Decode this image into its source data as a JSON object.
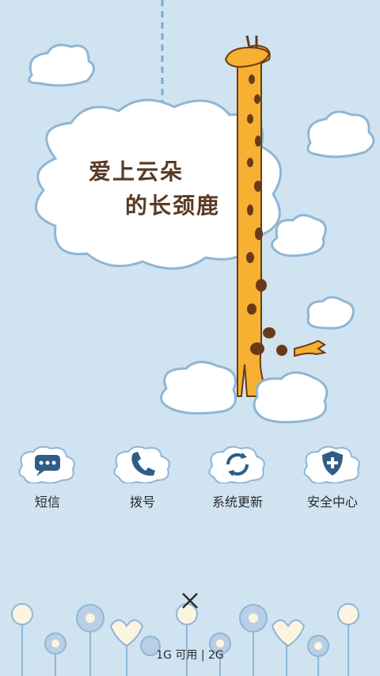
{
  "wallpaper": {
    "title_line1": "爱上云朵",
    "title_line2": "的长颈鹿"
  },
  "apps": [
    {
      "label": "短信",
      "icon": "chat-bubble-icon"
    },
    {
      "label": "拨号",
      "icon": "phone-icon"
    },
    {
      "label": "系统更新",
      "icon": "refresh-icon"
    },
    {
      "label": "安全中心",
      "icon": "shield-plus-icon"
    }
  ],
  "footer": {
    "close_icon": "close-icon",
    "memory_text": "1G 可用 | 2G"
  },
  "colors": {
    "background": "#cfe3f1",
    "cloud_fill": "#ffffff",
    "cloud_stroke": "#8fb6d4",
    "giraffe": "#f6b032",
    "giraffe_spots": "#6a3a18",
    "icon_blue": "#2f5d86"
  }
}
